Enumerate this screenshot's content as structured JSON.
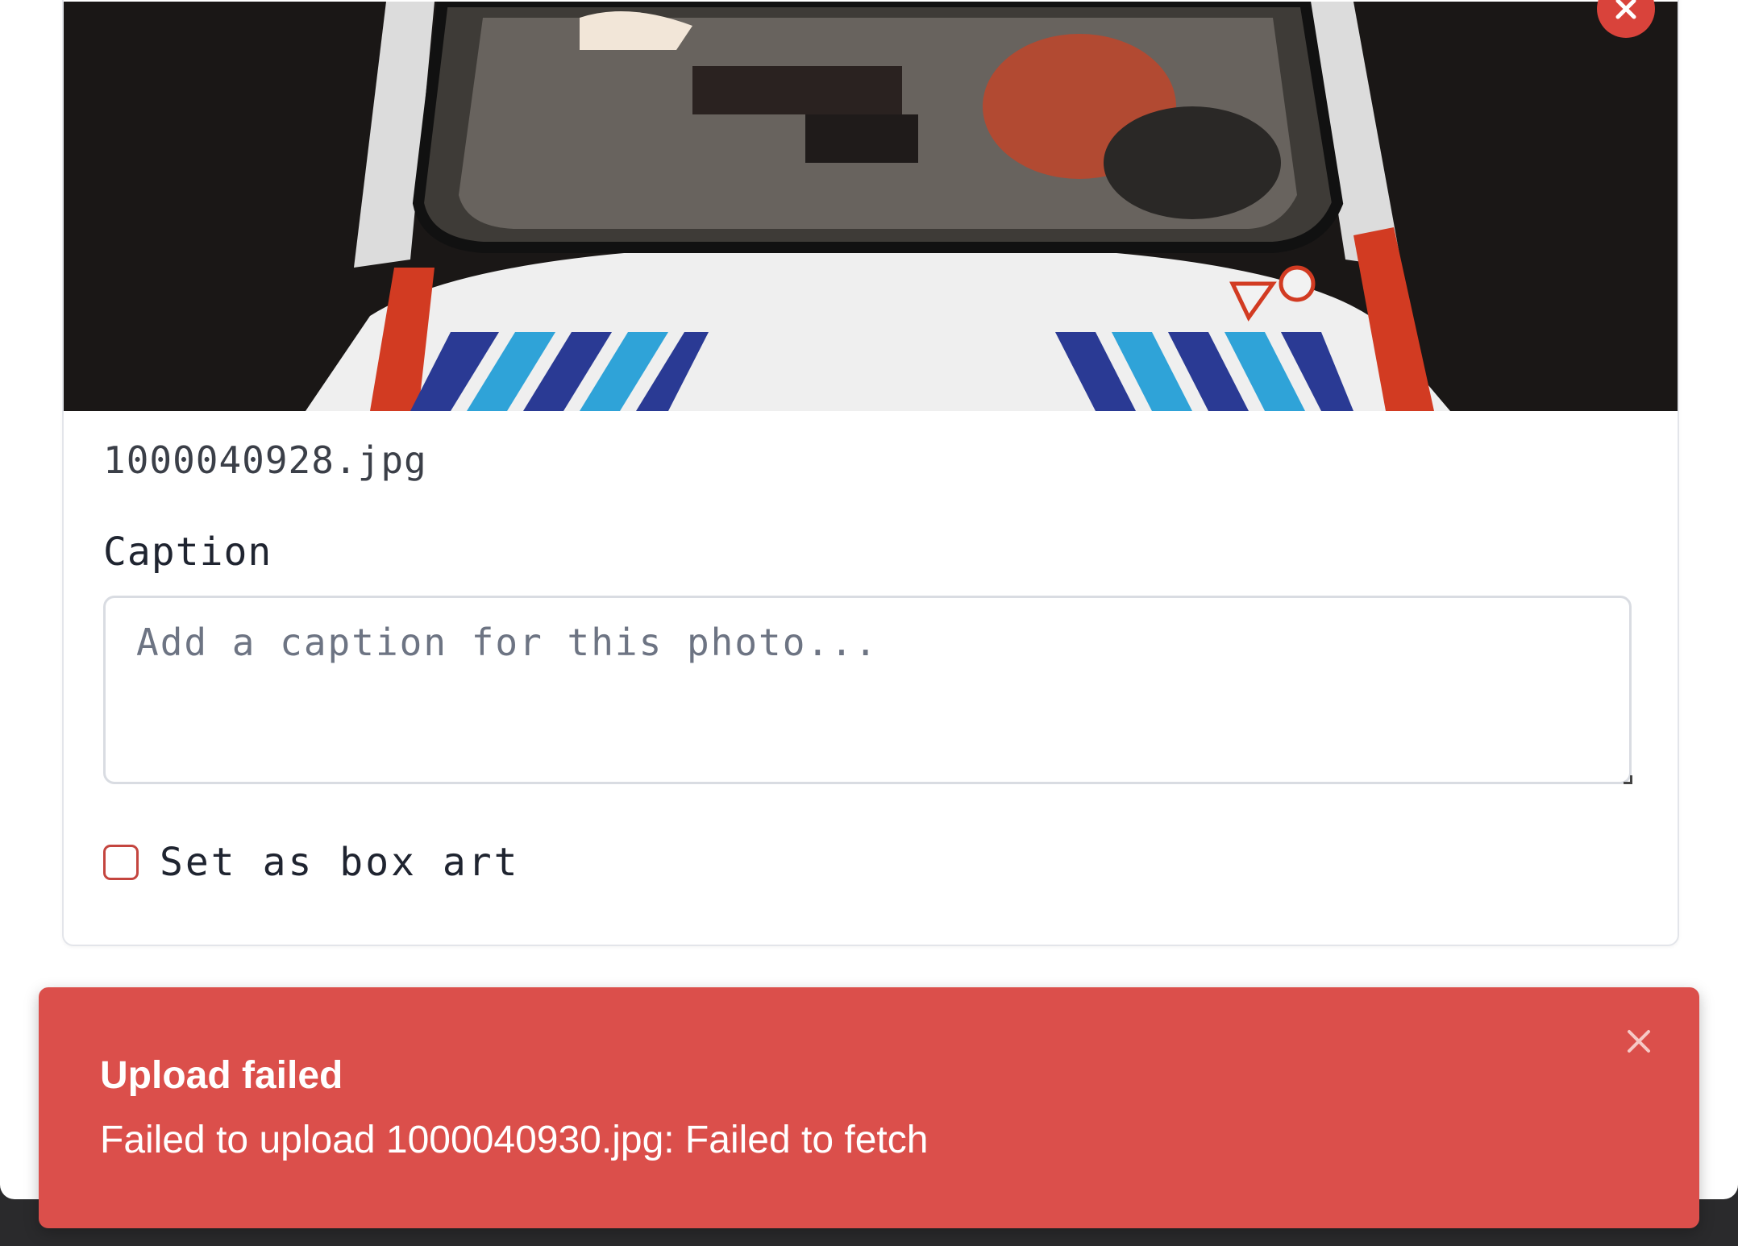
{
  "photo": {
    "filename": "1000040928.jpg",
    "subject_icon": "photo-preview"
  },
  "caption": {
    "label": "Caption",
    "placeholder": "Add a caption for this photo...",
    "value": ""
  },
  "box_art": {
    "label": "Set as box art",
    "checked": false
  },
  "toast": {
    "title": "Upload failed",
    "message": "Failed to upload 1000040930.jpg: Failed to fetch",
    "color": "#db4f4b"
  },
  "colors": {
    "accent_red": "#d9433b",
    "card_border": "#e3e5ea"
  },
  "icons": {
    "remove_photo": "close-icon",
    "dismiss_toast": "close-icon"
  }
}
